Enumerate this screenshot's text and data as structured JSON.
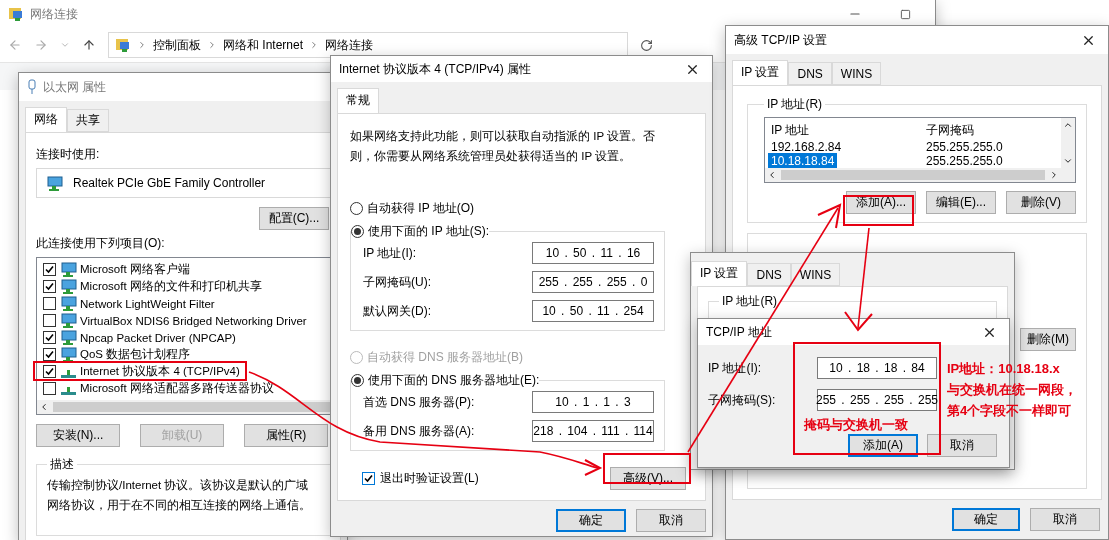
{
  "explorer": {
    "title": "网络连接",
    "breadcrumb": [
      "控制面板",
      "网络和 Internet",
      "网络连接"
    ]
  },
  "ethernet": {
    "title": "以太网 属性",
    "tabs": [
      {
        "label": "网络",
        "selected": true
      },
      {
        "label": "共享",
        "selected": false
      }
    ],
    "connect_label": "连接时使用:",
    "adapter": "Realtek PCIe GbE Family Controller",
    "configure_button": "配置(C)...",
    "items_label": "此连接使用下列项目(O):",
    "items": [
      {
        "label": "Microsoft 网络客户端",
        "checked": true,
        "kind": "client"
      },
      {
        "label": "Microsoft 网络的文件和打印机共享",
        "checked": true,
        "kind": "client"
      },
      {
        "label": "Network LightWeight Filter",
        "checked": false,
        "kind": "client"
      },
      {
        "label": "VirtualBox NDIS6 Bridged Networking Driver",
        "checked": false,
        "kind": "client"
      },
      {
        "label": "Npcap Packet Driver (NPCAP)",
        "checked": true,
        "kind": "client"
      },
      {
        "label": "QoS 数据包计划程序",
        "checked": true,
        "kind": "client"
      },
      {
        "label": "Internet 协议版本 4 (TCP/IPv4)",
        "checked": true,
        "kind": "protocol"
      },
      {
        "label": "Microsoft 网络适配器多路传送器协议",
        "checked": false,
        "kind": "protocol"
      }
    ],
    "buttons": [
      {
        "label": "安装(N)...",
        "disabled": false
      },
      {
        "label": "卸载(U)",
        "disabled": true
      },
      {
        "label": "属性(R)",
        "disabled": false
      }
    ],
    "description_label": "描述",
    "description": "传输控制协议/Internet 协议。该协议是默认的广域网络协议，用于在不同的相互连接的网络上通信。"
  },
  "ipv4": {
    "title": "Internet 协议版本 4 (TCP/IPv4) 属性",
    "tabs": [
      {
        "label": "常规",
        "selected": true
      }
    ],
    "intro": "如果网络支持此功能，则可以获取自动指派的 IP 设置。否则，你需要从网络系统管理员处获得适当的 IP 设置。",
    "ip_modes": [
      {
        "label": "自动获得 IP 地址(O)",
        "selected": false,
        "disabled": false
      },
      {
        "label": "使用下面的 IP 地址(S):",
        "selected": true,
        "disabled": false
      }
    ],
    "ip_fields": [
      {
        "label": "IP 地址(I):",
        "value": "10 . 50 . 11 . 16"
      },
      {
        "label": "子网掩码(U):",
        "value": "255 . 255 . 255 . 0"
      },
      {
        "label": "默认网关(D):",
        "value": "10 . 50 . 11 . 254"
      }
    ],
    "dns_modes": [
      {
        "label": "自动获得 DNS 服务器地址(B)",
        "selected": false,
        "disabled": true
      },
      {
        "label": "使用下面的 DNS 服务器地址(E):",
        "selected": true,
        "disabled": false
      }
    ],
    "dns_fields": [
      {
        "label": "首选 DNS 服务器(P):",
        "value": "10 . 1 . 1 . 3"
      },
      {
        "label": "备用 DNS 服务器(A):",
        "value": "218 . 104 . 111 . 114"
      }
    ],
    "validate": {
      "label": "退出时验证设置(L)",
      "checked": true
    },
    "advanced_button": "高级(V)...",
    "ok": "确定",
    "cancel": "取消"
  },
  "advanced": {
    "title": "高级 TCP/IP 设置",
    "tabs": [
      {
        "label": "IP 设置",
        "selected": true
      },
      {
        "label": "DNS",
        "selected": false
      },
      {
        "label": "WINS",
        "selected": false
      }
    ],
    "group_label": "IP 地址(R)",
    "columns": [
      "IP 地址",
      "子网掩码"
    ],
    "rows": [
      {
        "ip": "192.168.2.84",
        "mask": "255.255.255.0",
        "selected": false
      },
      {
        "ip": "10.18.18.84",
        "mask": "255.255.255.0",
        "selected": true
      }
    ],
    "buttons": [
      "添加(A)...",
      "编辑(E)...",
      "删除(V)"
    ],
    "lower_button": "删除(M)",
    "ok": "确定",
    "cancel": "取消"
  },
  "advanced_copy": {
    "tabs": [
      {
        "label": "IP 设置",
        "selected": true
      },
      {
        "label": "DNS",
        "selected": false
      },
      {
        "label": "WINS",
        "selected": false
      }
    ],
    "group_label": "IP 地址(R)"
  },
  "tcpip_dialog": {
    "title": "TCP/IP 地址",
    "fields": [
      {
        "label": "IP 地址(I):",
        "value": "10 . 18 . 18 . 84"
      },
      {
        "label": "子网掩码(S):",
        "value": "255 . 255 . 255 . 255"
      }
    ],
    "add": "添加(A)",
    "cancel": "取消"
  },
  "annotations": {
    "ip_note": [
      "IP地址：10.18.18.x",
      "与交换机在统一网段，",
      "第4个字段不一样即可"
    ],
    "mask_note": "掩码与交换机一致"
  }
}
